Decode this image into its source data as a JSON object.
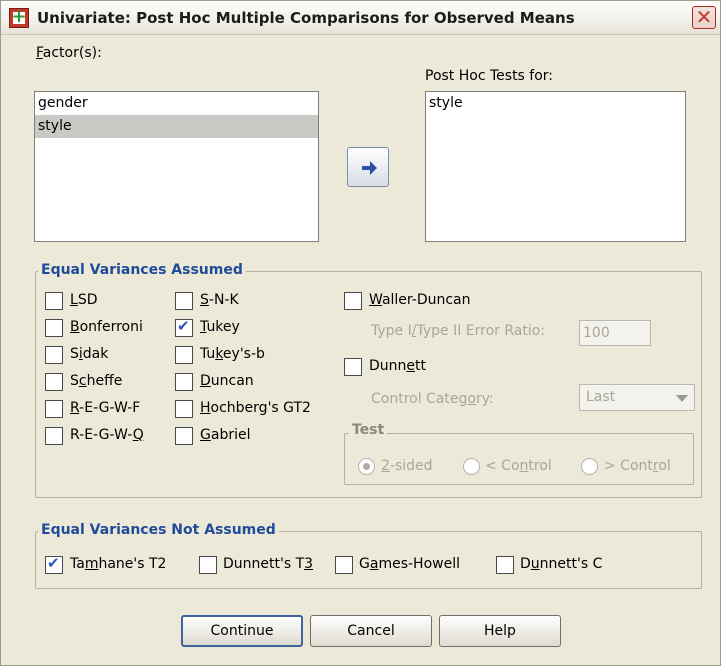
{
  "window": {
    "title": "Univariate: Post Hoc Multiple Comparisons for Observed Means",
    "close_glyph": "✕"
  },
  "factors": {
    "label_key": "F",
    "label_rest": "actor(s):",
    "items": [
      "gender",
      "style"
    ],
    "selected": "style"
  },
  "posthoc": {
    "label": "Post Hoc Tests for:",
    "items": [
      "style"
    ]
  },
  "equal_assumed": {
    "title": "Equal Variances Assumed",
    "tests": [
      {
        "pre": "",
        "key": "L",
        "post": "SD",
        "checked": false
      },
      {
        "pre": "",
        "key": "B",
        "post": "onferroni",
        "checked": false
      },
      {
        "pre": "S",
        "key": "i",
        "post": "dak",
        "checked": false
      },
      {
        "pre": "S",
        "key": "c",
        "post": "heffe",
        "checked": false
      },
      {
        "pre": "",
        "key": "R",
        "post": "-E-G-W-F",
        "checked": false
      },
      {
        "pre": "R-E-G-W-",
        "key": "Q",
        "post": "",
        "checked": false
      },
      {
        "pre": "",
        "key": "S",
        "post": "-N-K",
        "checked": false
      },
      {
        "pre": "",
        "key": "T",
        "post": "ukey",
        "checked": true
      },
      {
        "pre": "Tu",
        "key": "k",
        "post": "ey's-b",
        "checked": false
      },
      {
        "pre": "",
        "key": "D",
        "post": "uncan",
        "checked": false
      },
      {
        "pre": "",
        "key": "H",
        "post": "ochberg's GT2",
        "checked": false
      },
      {
        "pre": "",
        "key": "G",
        "post": "abriel",
        "checked": false
      },
      {
        "pre": "",
        "key": "W",
        "post": "aller-Duncan",
        "checked": false
      },
      {
        "pre": "Dunn",
        "key": "e",
        "post": "tt",
        "checked": false
      }
    ],
    "ratio_label_pre": "Type I",
    "ratio_label_key": "/",
    "ratio_label_post": "Type II Error Ratio:",
    "ratio_value": "100",
    "control_label_pre": "Control Categ",
    "control_label_key": "o",
    "control_label_post": "ry:",
    "control_value": "Last",
    "test_group_title": "Test",
    "radios": [
      {
        "pre": "",
        "key": "2",
        "post": "-sided",
        "selected": true
      },
      {
        "pre": "< Co",
        "key": "n",
        "post": "trol",
        "selected": false
      },
      {
        "pre": "> Cont",
        "key": "r",
        "post": "ol",
        "selected": false
      }
    ]
  },
  "not_assumed": {
    "title": "Equal Variances Not Assumed",
    "tests": [
      {
        "pre": "Ta",
        "key": "m",
        "post": "hane's T2",
        "checked": true
      },
      {
        "pre": "Dunnett's T",
        "key": "3",
        "post": "",
        "checked": false
      },
      {
        "pre": "G",
        "key": "a",
        "post": "mes-Howell",
        "checked": false
      },
      {
        "pre": "D",
        "key": "u",
        "post": "nnett's C",
        "checked": false
      }
    ]
  },
  "buttons": {
    "continue": "Continue",
    "cancel": "Cancel",
    "help": "Help"
  }
}
